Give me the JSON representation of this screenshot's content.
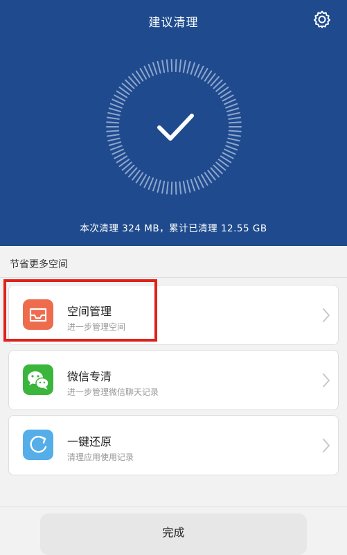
{
  "header": {
    "title": "建议清理",
    "summary": "本次清理 324 MB，累计已清理 12.55 GB"
  },
  "section": {
    "label": "节省更多空间"
  },
  "items": [
    {
      "name": "空间管理",
      "desc": "进一步管理空间",
      "icon": "tray-icon",
      "color": "#ee6b4d"
    },
    {
      "name": "微信专清",
      "desc": "进一步管理微信聊天记录",
      "icon": "wechat-icon",
      "color": "#3bb53c"
    },
    {
      "name": "一键还原",
      "desc": "清理应用使用记录",
      "icon": "restore-icon",
      "color": "#55aee8"
    }
  ],
  "footer": {
    "done_label": "完成"
  },
  "colors": {
    "header_bg": "#1f4b8e",
    "highlight": "#e0211b"
  }
}
